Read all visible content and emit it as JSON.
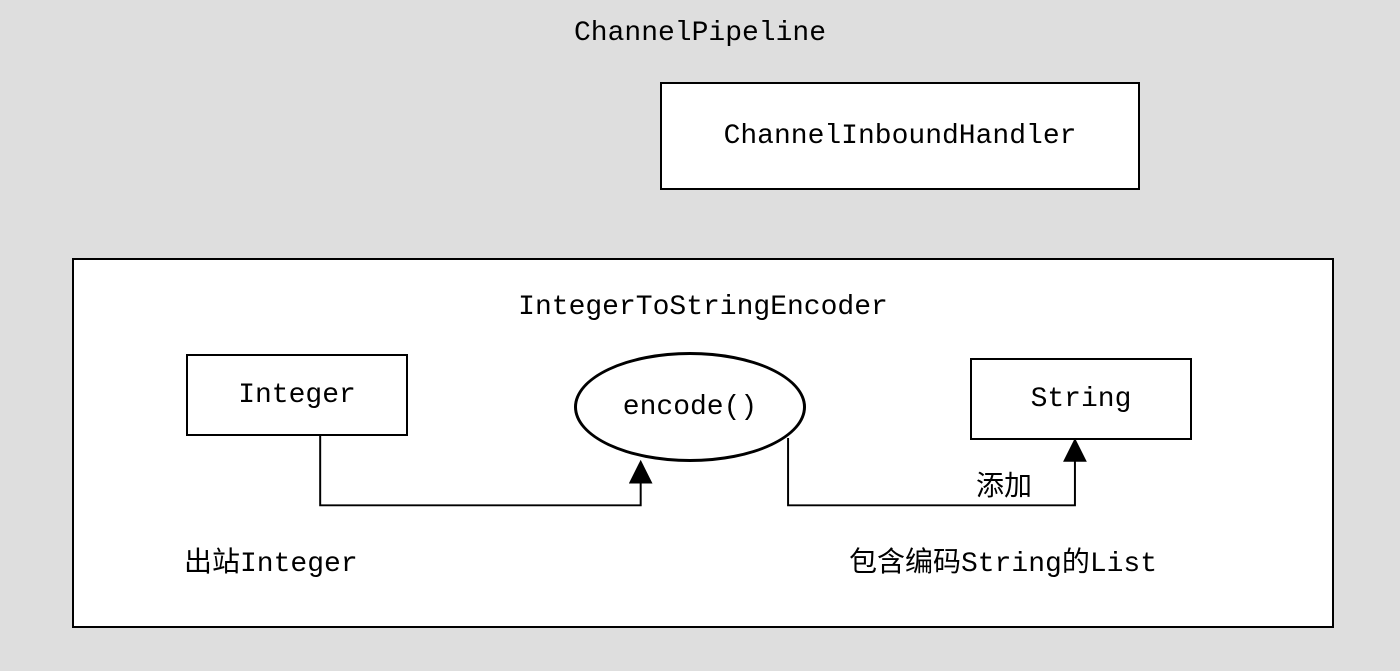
{
  "title": "ChannelPipeline",
  "inbound_handler": "ChannelInboundHandler",
  "encoder": {
    "title": "IntegerToStringEncoder",
    "input_box": "Integer",
    "process": "encode()",
    "output_box": "String",
    "outbound_label": "出站Integer",
    "list_label": "包含编码String的List",
    "add_label": "添加"
  }
}
